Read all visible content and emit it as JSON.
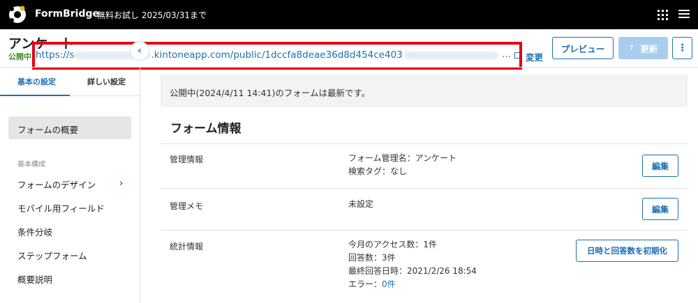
{
  "topbar": {
    "brand": "FormBridge",
    "trial_text": "無料お試し 2025/03/31まで",
    "icons": [
      "formbridge-logo-icon",
      "app-grid-icon",
      "hamburger-menu-icon"
    ]
  },
  "header": {
    "title": "アンケート",
    "status": "公開中",
    "url_prefix": "https://s",
    "url_middle": ".kintoneapp.com/public/1dccfa8deae36d8d454ce403",
    "url_ellipsis": "…",
    "change_label": "変更",
    "preview_label": "プレビュー",
    "update_label": "更新",
    "more_label": "⋮"
  },
  "sidebar": {
    "tabs": [
      {
        "label": "基本の設定",
        "active": true
      },
      {
        "label": "詳しい設定",
        "active": false
      }
    ],
    "active_item": "フォームの概要",
    "section_label": "基本構成",
    "items": [
      {
        "label": "フォームのデザイン"
      },
      {
        "label": "モバイル用フィールド"
      },
      {
        "label": "条件分岐"
      },
      {
        "label": "ステップフォーム"
      },
      {
        "label": "概要説明"
      }
    ]
  },
  "main": {
    "notice": "公開中(2024/4/11 14:41)のフォームは最新です。",
    "section_title": "フォーム情報",
    "rows": [
      {
        "label": "管理情報",
        "lines": [
          "フォーム管理名：アンケート",
          "検索タグ：なし"
        ],
        "button": "編集"
      },
      {
        "label": "管理メモ",
        "lines": [
          "未設定"
        ],
        "button": "編集"
      },
      {
        "label": "統計情報",
        "lines": [
          "今月のアクセス数：1件",
          "回答数：3件",
          "最終回答日時：2021/2/26 18:54"
        ],
        "error_prefix": "エラー：",
        "error_value": "0件",
        "button": "日時と回答数を初期化"
      }
    ]
  },
  "colors": {
    "accent": "#1a6fb5",
    "status_green": "#3b8c28",
    "highlight_red": "#e60012",
    "topbar": "#000000"
  }
}
